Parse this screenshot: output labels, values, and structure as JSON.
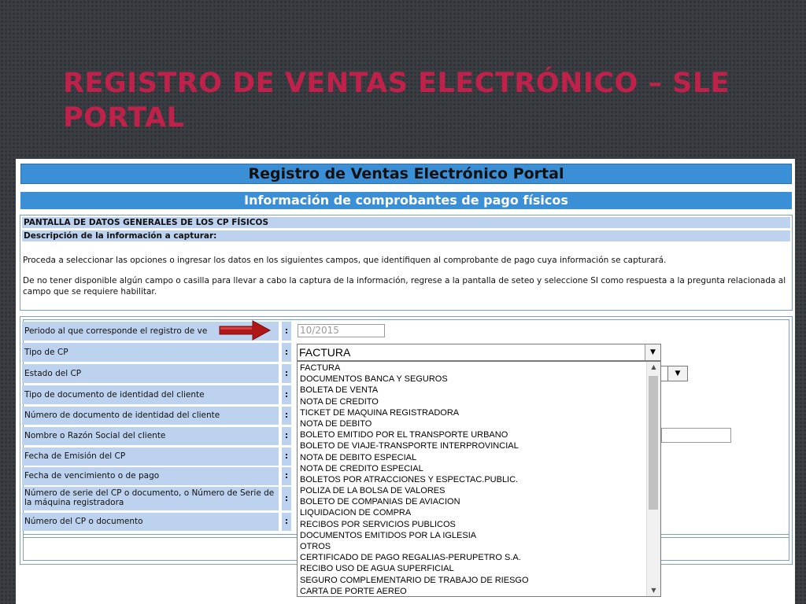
{
  "slide": {
    "title": "REGISTRO DE VENTAS ELECTRÓNICO – SLE PORTAL"
  },
  "portal": {
    "title": "Registro de Ventas Electrónico Portal",
    "subtitle": "Información de comprobantes de pago físicos",
    "screen_title": "PANTALLA DE DATOS GENERALES DE LOS CP FÍSICOS",
    "description_heading": "Descripción de la información a capturar:",
    "instruction_1": "Proceda a seleccionar las opciones o ingresar los datos en los siguientes campos, que identifiquen al comprobante de pago cuya información se capturará.",
    "instruction_2": "De no tener disponible algún campo o casilla para llevar a cabo la captura de la información, regrese a la pantalla de seteo y seleccione SI como respuesta a la pregunta relacionada al campo que se requiere habilitar."
  },
  "form": {
    "colon": ":",
    "labels": [
      "Periodo al que corresponde el registro de ve",
      "Tipo de CP",
      "Estado del CP",
      "Tipo de documento de identidad del cliente",
      "Número de documento de identidad del cliente",
      "Nombre o Razón Social del cliente",
      "Fecha de Emisión del CP",
      "Fecha de vencimiento o de pago",
      "Número de serie del CP o documento, o Número de Serie de la máquina registradora",
      "Número del CP o documento"
    ],
    "period_value": "10/2015",
    "tipo_cp_value": "FACTURA",
    "caret": "▼"
  },
  "dropdown": {
    "options": [
      "FACTURA",
      "DOCUMENTOS BANCA Y SEGUROS",
      "BOLETA DE VENTA",
      "NOTA DE CREDITO",
      "TICKET DE MAQUINA REGISTRADORA",
      "NOTA DE DEBITO",
      "BOLETO EMITIDO POR EL TRANSPORTE URBANO",
      "BOLETO DE VIAJE-TRANSPORTE INTERPROVINCIAL",
      "NOTA DE DEBITO ESPECIAL",
      "NOTA DE CREDITO ESPECIAL",
      "BOLETOS POR ATRACCIONES Y ESPECTAC.PUBLIC.",
      "POLIZA DE LA BOLSA DE VALORES",
      "BOLETO DE COMPANIAS DE AVIACION",
      "LIQUIDACION DE COMPRA",
      "RECIBOS POR SERVICIOS PUBLICOS",
      "DOCUMENTOS EMITIDOS POR LA IGLESIA",
      "OTROS",
      "CERTIFICADO DE PAGO REGALIAS-PERUPETRO S.A.",
      "RECIBO USO DE AGUA SUPERFICIAL",
      "SEGURO COMPLEMENTARIO DE TRABAJO DE RIESGO",
      "CARTA DE PORTE AEREO"
    ],
    "scroll_up": "▲",
    "scroll_down": "▼"
  },
  "colors": {
    "slide_title": "#c0214a",
    "header_blue": "#3b8fd6",
    "label_bg": "#bcd2ee",
    "arrow_red": "#b01818"
  }
}
